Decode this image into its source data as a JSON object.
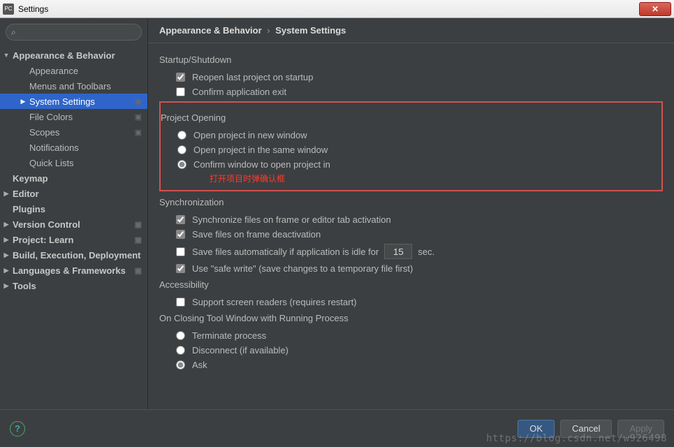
{
  "window": {
    "title": "Settings"
  },
  "search": {
    "placeholder": ""
  },
  "sidebar": {
    "items": [
      {
        "label": "Appearance & Behavior",
        "level": 1,
        "arrow": "down",
        "bold": true
      },
      {
        "label": "Appearance",
        "level": 2
      },
      {
        "label": "Menus and Toolbars",
        "level": 2
      },
      {
        "label": "System Settings",
        "level": 2,
        "arrow": "right",
        "selected": true,
        "badge": true
      },
      {
        "label": "File Colors",
        "level": 2,
        "badge": true
      },
      {
        "label": "Scopes",
        "level": 2,
        "badge": true
      },
      {
        "label": "Notifications",
        "level": 2
      },
      {
        "label": "Quick Lists",
        "level": 2
      },
      {
        "label": "Keymap",
        "level": 1,
        "bold": true
      },
      {
        "label": "Editor",
        "level": 1,
        "arrow": "right",
        "bold": true
      },
      {
        "label": "Plugins",
        "level": 1,
        "bold": true
      },
      {
        "label": "Version Control",
        "level": 1,
        "arrow": "right",
        "bold": true,
        "badge": true
      },
      {
        "label": "Project: Learn",
        "level": 1,
        "arrow": "right",
        "bold": true,
        "badge": true
      },
      {
        "label": "Build, Execution, Deployment",
        "level": 1,
        "arrow": "right",
        "bold": true
      },
      {
        "label": "Languages & Frameworks",
        "level": 1,
        "arrow": "right",
        "bold": true,
        "badge": true
      },
      {
        "label": "Tools",
        "level": 1,
        "arrow": "right",
        "bold": true
      }
    ]
  },
  "breadcrumb": {
    "parent": "Appearance & Behavior",
    "current": "System Settings"
  },
  "startup": {
    "title": "Startup/Shutdown",
    "reopen": "Reopen last project on startup",
    "confirm_exit": "Confirm application exit"
  },
  "project_opening": {
    "title": "Project Opening",
    "opt_new": "Open project in new window",
    "opt_same": "Open project in the same window",
    "opt_confirm": "Confirm window to open project in",
    "annotation": "打开项目时弹确认框"
  },
  "sync": {
    "title": "Synchronization",
    "activate": "Synchronize files on frame or editor tab activation",
    "save_deact": "Save files on frame deactivation",
    "auto_save_pre": "Save files automatically if application is idle for",
    "auto_save_val": "15",
    "auto_save_post": "sec.",
    "safe_write": "Use \"safe write\" (save changes to a temporary file first)"
  },
  "accessibility": {
    "title": "Accessibility",
    "screen_readers": "Support screen readers (requires restart)"
  },
  "closing": {
    "title": "On Closing Tool Window with Running Process",
    "terminate": "Terminate process",
    "disconnect": "Disconnect (if available)",
    "ask": "Ask"
  },
  "footer": {
    "ok": "OK",
    "cancel": "Cancel",
    "apply": "Apply"
  },
  "watermark": "https://blog.csdn.net/w926498"
}
